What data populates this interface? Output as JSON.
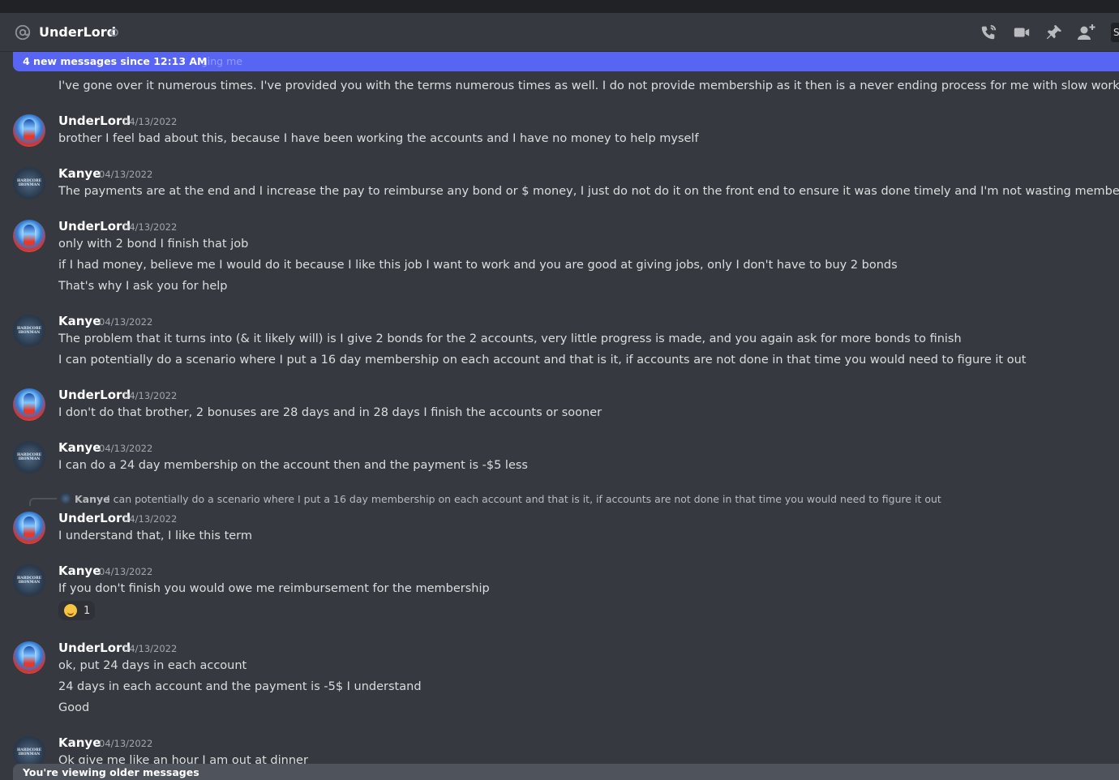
{
  "header": {
    "channel_name": "UnderLord",
    "icons": [
      "at-icon",
      "call-icon",
      "video-icon",
      "pin-icon",
      "add-friend-icon"
    ],
    "search_partial": "S"
  },
  "new_messages_bar": {
    "label": "4 new messages since 12:13 AM",
    "ghost_text": "ging me"
  },
  "messages": [
    {
      "author": "",
      "time": "",
      "lines": [
        "I've gone over it numerous times. I've provided you with the terms numerous times as well. I do not provide membership as it then is a never ending process for me with slow work."
      ]
    },
    {
      "author": "UnderLord",
      "time": "04/13/2022",
      "lines": [
        "brother I feel bad about this, because I have been working the accounts and I have no money to help myself"
      ]
    },
    {
      "author": "Kanye",
      "time": "04/13/2022",
      "avatar_text": "HARDCORE IRONMAN",
      "lines": [
        "The payments are at the end and I increase the pay to reimburse any bond or $ money, I just do not do it on the front end to ensure it was done timely and I'm not wasting membership on slow work."
      ]
    },
    {
      "author": "UnderLord",
      "time": "04/13/2022",
      "lines": [
        "only with 2 bond I finish that job",
        "if I had money, believe me I would do it because I like this job I want to work and you are good at giving jobs, only I don't have to buy 2 bonds",
        "That's why I ask you for help"
      ]
    },
    {
      "author": "Kanye",
      "time": "04/13/2022",
      "avatar_text": "HARDCORE IRONMAN",
      "lines": [
        "The problem that it turns into (& it likely will) is I give 2 bonds for the 2 accounts, very little progress is made, and you again ask for more bonds to finish",
        "I can potentially do a scenario where I put a 16 day membership on each account and that is it, if accounts are not done in that time you would need to figure it out"
      ]
    },
    {
      "author": "UnderLord",
      "time": "04/13/2022",
      "lines": [
        "I don't do that brother, 2 bonuses are 28 days and in 28 days I finish the accounts or sooner"
      ]
    },
    {
      "author": "Kanye",
      "time": "04/13/2022",
      "avatar_text": "HARDCORE IRONMAN",
      "lines": [
        "I can do a 24 day membership on the account then and the payment is -$5 less"
      ]
    },
    {
      "author": "UnderLord",
      "time": "04/13/2022",
      "reply": {
        "author": "Kanye",
        "text": "I can potentially do a scenario where I put a 16 day membership on each account and that is it, if accounts are not done in that time you would need to figure it out"
      },
      "lines": [
        "I understand that, I like this term"
      ]
    },
    {
      "author": "Kanye",
      "time": "04/13/2022",
      "avatar_text": "HARDCORE IRONMAN",
      "lines": [
        "If you don't finish you would owe me reimbursement for the membership"
      ],
      "reaction": {
        "emoji": "smiling-face",
        "count": "1"
      }
    },
    {
      "author": "UnderLord",
      "time": "04/13/2022",
      "lines": [
        "ok, put 24 days in each account",
        "24 days in each account and the payment is -5$ I understand",
        "Good"
      ]
    },
    {
      "author": "Kanye",
      "time": "04/13/2022",
      "avatar_text": "HARDCORE IRONMAN",
      "lines": [
        "Ok give me like an hour I am out at dinner"
      ]
    }
  ],
  "older_messages_bar": {
    "label": "You're viewing older messages"
  }
}
